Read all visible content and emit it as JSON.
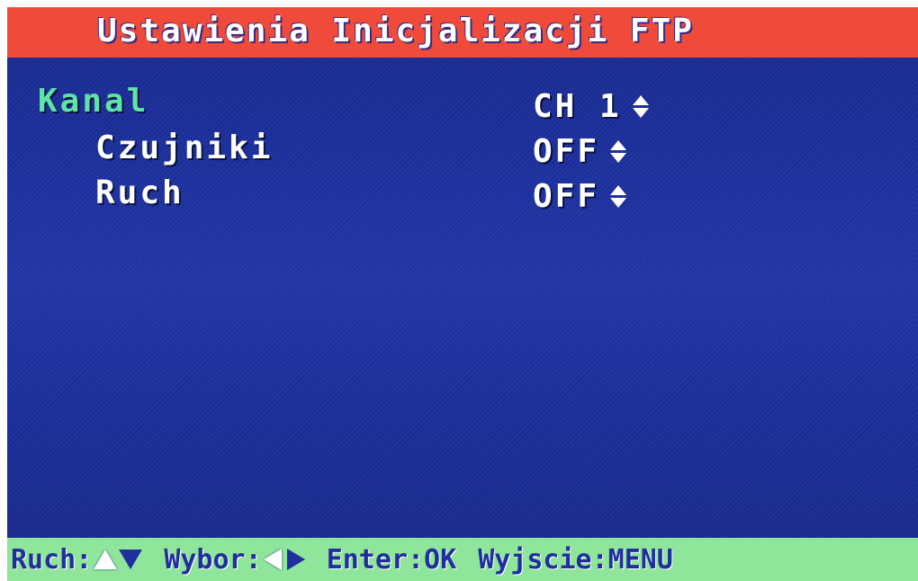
{
  "title": "Ustawienia Inicjalizacji FTP",
  "rows": [
    {
      "label": "Kanal",
      "value": "CH 1",
      "selected": true
    },
    {
      "label": "Czujniki",
      "value": "OFF",
      "selected": false
    },
    {
      "label": "Ruch",
      "value": "OFF",
      "selected": false
    }
  ],
  "footer": {
    "move_label": "Ruch:",
    "select_label": "Wybor:",
    "enter_label": "Enter:OK",
    "exit_label": "Wyjscie:MENU"
  },
  "colors": {
    "title_bar": "#f04a3a",
    "background": "#1c2f9e",
    "selected_label": "#5fe3a8",
    "footer_bar": "#8fe59a",
    "footer_text": "#1f2f9e"
  },
  "icons": [
    "up-down-arrow-icon",
    "triangle-up-icon",
    "triangle-down-icon",
    "triangle-left-icon",
    "triangle-right-icon"
  ]
}
